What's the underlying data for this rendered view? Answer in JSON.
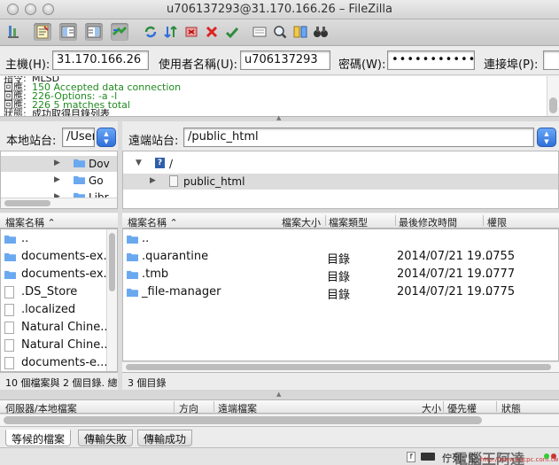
{
  "window": {
    "title": "u706137293@31.170.166.26 – FileZilla"
  },
  "quickconnect": {
    "host_label": "主機(H):",
    "host_value": "31.170.166.26",
    "user_label": "使用者名稱(U):",
    "user_value": "u706137293",
    "pass_label": "密碼(W):",
    "pass_value": "•••••••••••",
    "port_label": "連接埠(P):"
  },
  "log": [
    {
      "tag": "指令:",
      "msg": "MLSD",
      "color": "dark"
    },
    {
      "tag": "回應:",
      "msg": "150 Accepted data connection",
      "color": "green"
    },
    {
      "tag": "回應:",
      "msg": "226-Options: -a -l",
      "color": "green"
    },
    {
      "tag": "回應:",
      "msg": "226 5 matches total",
      "color": "green"
    },
    {
      "tag": "狀態:",
      "msg": "成功取得目錄列表",
      "color": "dark"
    }
  ],
  "local": {
    "site_label": "本地站台:",
    "path": "/User",
    "tree": [
      {
        "label": "Dov"
      },
      {
        "label": "Go"
      },
      {
        "label": "Libr"
      }
    ],
    "headers": {
      "name": "檔案名稱"
    },
    "files": [
      {
        "name": "..",
        "type": "folder"
      },
      {
        "name": "documents-ex...",
        "type": "folder"
      },
      {
        "name": "documents-ex...",
        "type": "folder"
      },
      {
        "name": ".DS_Store",
        "type": "file"
      },
      {
        "name": ".localized",
        "type": "file"
      },
      {
        "name": "Natural Chine...",
        "type": "file"
      },
      {
        "name": "Natural Chine...",
        "type": "file"
      },
      {
        "name": "documents-e...",
        "type": "file"
      }
    ],
    "status": "10 個檔案與 2 個目錄. 總大"
  },
  "remote": {
    "site_label": "遠端站台:",
    "path": "/public_html",
    "tree": [
      {
        "label": "/"
      },
      {
        "label": "public_html"
      }
    ],
    "headers": {
      "name": "檔案名稱",
      "size": "檔案大小",
      "type": "檔案類型",
      "modified": "最後修改時間",
      "perms": "權限"
    },
    "files": [
      {
        "name": "..",
        "type": "",
        "modified": "",
        "perms": ""
      },
      {
        "name": ".quarantine",
        "type": "目錄",
        "modified": "2014/07/21 19...",
        "perms": "0755"
      },
      {
        "name": ".tmb",
        "type": "目錄",
        "modified": "2014/07/21 19...",
        "perms": "0777"
      },
      {
        "name": "_file-manager",
        "type": "目錄",
        "modified": "2014/07/21 19...",
        "perms": "0775"
      }
    ],
    "status": "3 個目錄"
  },
  "queue": {
    "headers": {
      "server": "伺服器/本地檔案",
      "direction": "方向",
      "remote": "遠端檔案",
      "size": "大小",
      "priority": "優先權",
      "status": "狀態"
    }
  },
  "tabs": [
    {
      "label": "等候的檔案"
    },
    {
      "label": "傳輸失敗"
    },
    {
      "label": "傳輸成功"
    }
  ],
  "bottom": {
    "queue_label": "佇列: 空",
    "watermark": "電腦王阿達",
    "watermark_url": "http://www.kocpc.com.tw"
  },
  "colors": {
    "accent": "#2f6fd9",
    "log_green": "#1f8a1f",
    "folder": "#6aa8f0"
  }
}
